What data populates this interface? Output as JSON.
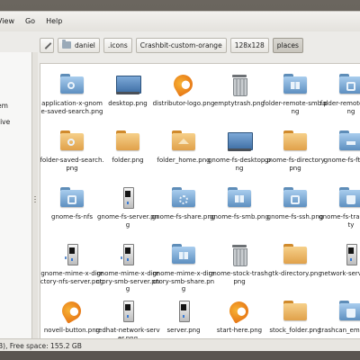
{
  "menu": [
    "View",
    "Go",
    "Help"
  ],
  "path_buttons": [
    {
      "label": "daniel"
    },
    {
      "label": ".icons"
    },
    {
      "label": "Crashbit-custom-orange"
    },
    {
      "label": "128x128"
    },
    {
      "label": "places",
      "active": true
    }
  ],
  "sidebar": {
    "items": [
      "em",
      "rive"
    ]
  },
  "files": [
    {
      "name": "application-x-gnome-saved-search.png",
      "icon": "folder-search-icon",
      "style": "folder",
      "color": "blue",
      "emblem": "search"
    },
    {
      "name": "desktop.png",
      "icon": "desktop-icon",
      "style": "desktop"
    },
    {
      "name": "distributor-logo.png",
      "icon": "distributor-logo-icon",
      "style": "flame"
    },
    {
      "name": "emptytrash.png",
      "icon": "trash-empty-icon",
      "style": "trash"
    },
    {
      "name": "folder-remote-smb.png",
      "icon": "folder-smb-icon",
      "style": "folder",
      "color": "blue",
      "emblem": "win"
    },
    {
      "name": "folder-remote-ssh.png",
      "icon": "folder-ssh-icon",
      "style": "folder",
      "color": "blue",
      "emblem": "net"
    },
    {
      "name": "folder-saved-search.png",
      "icon": "folder-saved-search-icon",
      "style": "folder",
      "color": "gold",
      "emblem": "search"
    },
    {
      "name": "folder.png",
      "icon": "folder-icon",
      "style": "folder",
      "color": "gold"
    },
    {
      "name": "folder_home.png",
      "icon": "folder-home-icon",
      "style": "folder",
      "color": "gold",
      "emblem": "home"
    },
    {
      "name": "gnome-fs-desktop.png",
      "icon": "desktop-icon",
      "style": "desktop"
    },
    {
      "name": "gnome-fs-directory.png",
      "icon": "folder-icon",
      "style": "folder",
      "color": "gold"
    },
    {
      "name": "gnome-fs-ftp.png",
      "icon": "folder-ftp-icon",
      "style": "folder",
      "color": "blue",
      "emblem": "ftp"
    },
    {
      "name": "gnome-fs-nfs",
      "icon": "folder-nfs-icon",
      "style": "folder",
      "color": "blue",
      "emblem": "net"
    },
    {
      "name": "gnome-fs-server.png",
      "icon": "server-icon",
      "style": "server"
    },
    {
      "name": "gnome-fs-share.png",
      "icon": "folder-share-icon",
      "style": "folder",
      "color": "blue",
      "emblem": "gear"
    },
    {
      "name": "gnome-fs-smb.png",
      "icon": "folder-smb-icon",
      "style": "folder",
      "color": "blue",
      "emblem": "win"
    },
    {
      "name": "gnome-fs-ssh.png",
      "icon": "folder-ssh-icon",
      "style": "folder",
      "color": "blue",
      "emblem": "net"
    },
    {
      "name": "gnome-fs-trash-empty",
      "icon": "folder-trash-icon",
      "style": "folder",
      "color": "blue",
      "emblem": "trash"
    },
    {
      "name": "gnome-mime-x-directory-nfs-server.png",
      "icon": "server-nfs-icon",
      "style": "server",
      "mime": true
    },
    {
      "name": "gnome-mime-x-directory-smb-server.png",
      "icon": "server-smb-icon",
      "style": "server",
      "mime": true
    },
    {
      "name": "gnome-mime-x-directory-smb-share.png",
      "icon": "folder-share-icon",
      "style": "folder",
      "color": "blue",
      "emblem": "win"
    },
    {
      "name": "gnome-stock-trash.png",
      "icon": "trash-icon",
      "style": "trash"
    },
    {
      "name": "gtk-directory.png",
      "icon": "folder-icon",
      "style": "folder",
      "color": "gold"
    },
    {
      "name": "network-server.png",
      "icon": "server-icon",
      "style": "server"
    },
    {
      "name": "novell-button.png",
      "icon": "novell-button-icon",
      "style": "flame"
    },
    {
      "name": "redhat-network-server.png",
      "icon": "server-icon",
      "style": "server"
    },
    {
      "name": "server.png",
      "icon": "server-icon",
      "style": "server"
    },
    {
      "name": "start-here.png",
      "icon": "start-here-icon",
      "style": "flame"
    },
    {
      "name": "stock_folder.png",
      "icon": "folder-icon",
      "style": "folder",
      "color": "gold"
    },
    {
      "name": "trashcan_empty.png",
      "icon": "trash-empty-icon",
      "style": "folder",
      "color": "blue",
      "emblem": "trash"
    }
  ],
  "status": "B), Free space: 155.2 GB"
}
